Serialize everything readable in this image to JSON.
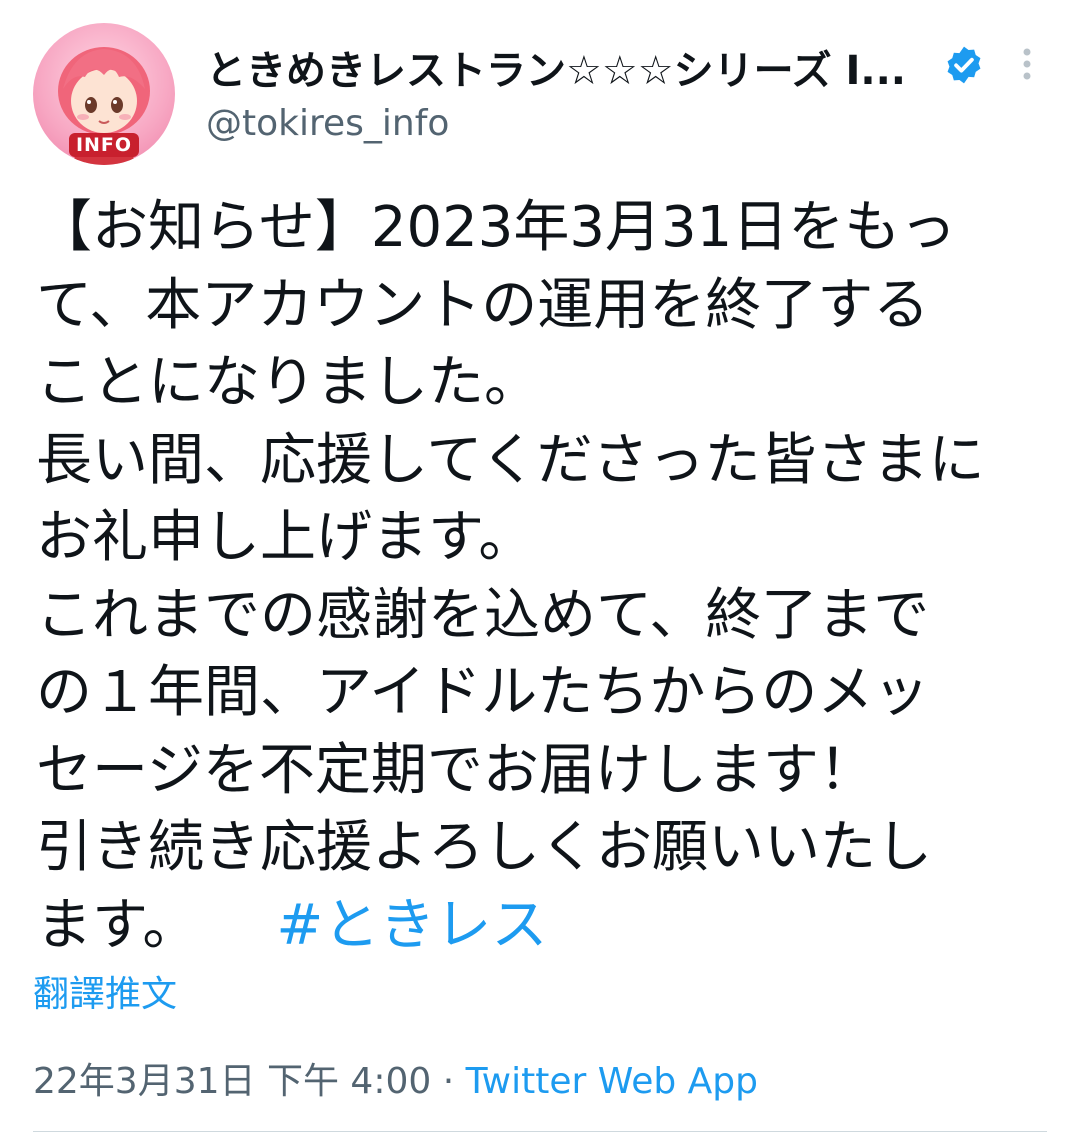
{
  "tweet": {
    "display_name": "ときめきレストラン☆☆☆シリーズ I...",
    "handle": "@tokires_info",
    "avatar_badge": "INFO",
    "verified": true,
    "lines": [
      "【お知らせ】2023年3月31日をもっ",
      "て、本アカウントの運用を終了する",
      "ことになりました。",
      "長い間、応援してくださった皆さまに",
      "お礼申し上げます。",
      "これまでの感謝を込めて、終了まで",
      "の１年間、アイドルたちからのメッ",
      "セージを不定期でお届けします！",
      "引き続き応援よろしくお願いいたし",
      "ます。"
    ],
    "hashtag": "#ときレス",
    "translate_label": "翻譯推文",
    "date": "22年3月31日",
    "time": "下午 4:00",
    "separator": "·",
    "source": "Twitter Web App"
  },
  "icons": {
    "verified": "verified-badge-icon",
    "more": "more-vertical-icon"
  },
  "colors": {
    "link": "#1d9bf0",
    "secondary_text": "#536471",
    "primary_text": "#0f1419"
  }
}
